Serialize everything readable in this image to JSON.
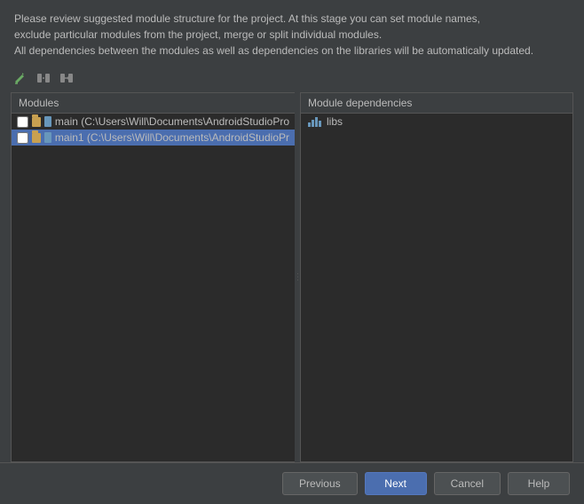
{
  "description": {
    "line1": "Please review suggested module structure for the project. At this stage you can set module names,",
    "line2": "exclude particular modules from the project, merge or split individual modules.",
    "line3": "All dependencies between the modules as well as dependencies on the libraries will be automatically updated."
  },
  "toolbar": {
    "edit_label": "Edit",
    "split_label": "Split",
    "merge_label": "Merge"
  },
  "modules_panel": {
    "header": "Modules",
    "items": [
      {
        "id": "main",
        "label": "main (C:\\Users\\Will\\Documents\\AndroidStudioPro",
        "checked": false,
        "selected": false
      },
      {
        "id": "main1",
        "label": "main1 (C:\\Users\\Will\\Documents\\AndroidStudioPr",
        "checked": false,
        "selected": true
      }
    ]
  },
  "dependencies_panel": {
    "header": "Module dependencies",
    "items": [
      {
        "id": "libs",
        "label": "libs"
      }
    ]
  },
  "footer": {
    "previous_label": "Previous",
    "next_label": "Next",
    "cancel_label": "Cancel",
    "help_label": "Help"
  }
}
